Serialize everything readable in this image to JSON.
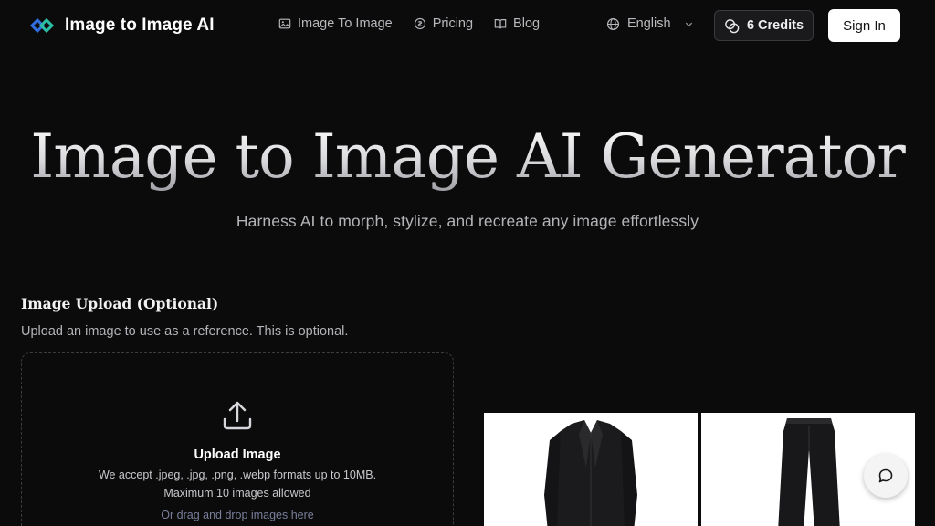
{
  "header": {
    "logo_text": "Image to Image AI",
    "nav": [
      {
        "label": "Image To Image",
        "icon": "image-icon"
      },
      {
        "label": "Pricing",
        "icon": "coin-icon"
      },
      {
        "label": "Blog",
        "icon": "book-icon"
      }
    ],
    "language": {
      "label": "English",
      "icon": "globe-icon"
    },
    "credits_label": "6 Credits",
    "signin_label": "Sign In"
  },
  "hero": {
    "title": "Image to Image AI Generator",
    "subtitle": "Harness AI to morph, stylize, and recreate any image effortlessly"
  },
  "upload": {
    "heading": "Image Upload (Optional)",
    "description": "Upload an image to use as a reference. This is optional.",
    "title": "Upload Image",
    "formats": "We accept .jpeg, .jpg, .png, .webp formats up to 10MB.",
    "max": "Maximum 10 images allowed",
    "drag": "Or drag and drop images here"
  },
  "colors": {
    "background": "#0b0b0c",
    "accent_logo_blue": "#3b82f6",
    "accent_logo_teal": "#2dd4bf"
  }
}
